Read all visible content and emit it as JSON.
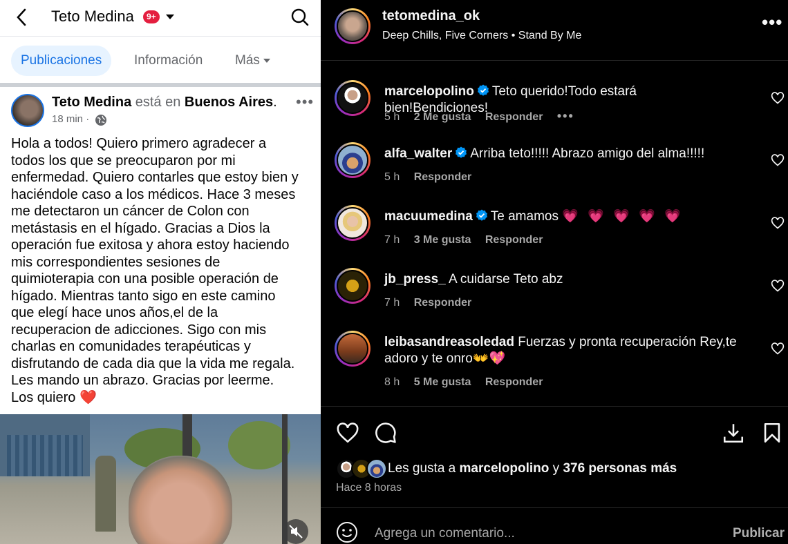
{
  "facebook": {
    "profile_name": "Teto Medina",
    "notification_badge": "9+",
    "tabs": [
      "Publicaciones",
      "Información",
      "Más"
    ],
    "post": {
      "author": "Teto Medina",
      "location_prefix": "está en",
      "location": "Buenos Aires",
      "time": "18 min ·",
      "body": "Hola a todos! Quiero primero agradecer a\ntodos los que se preocuparon por mi\nenfermedad. Quiero contarles que estoy bien y\nhaciéndole caso a los médicos. Hace 3 meses\nme detectaron un cáncer de Colon con\nmetástasis en el hígado. Gracias a Dios la\noperación fue exitosa y ahora estoy haciendo\nmis correspondientes sesiones de\nquimioterapia con una posible operación de\nhígado. Mientras tanto sigo en este camino\nque elegí hace unos años,el de la\nrecuperacion de adicciones.  Sigo con mis\ncharlas en comunidades terapéuticas y\ndisfrutando de cada dia que la vida me regala.\nLes mando un abrazo. Gracias por leerme.\nLos quiero ❤️"
    }
  },
  "instagram": {
    "username": "tetomedina_ok",
    "song": "Deep Chills, Five Corners • Stand By Me",
    "comments": [
      {
        "user": "marcelopolino",
        "verified": true,
        "text": "Teto querido!Todo estará bien!Bendiciones!",
        "time": "5 h",
        "likes": "2 Me gusta",
        "reply": "Responder",
        "more": "•••"
      },
      {
        "user": "alfa_walter",
        "verified": true,
        "text": "Arriba teto!!!!! Abrazo amigo del alma!!!!!",
        "time": "5 h",
        "likes": "",
        "reply": "Responder"
      },
      {
        "user": "macuumedina",
        "verified": true,
        "text": "Te amamos",
        "emoji": "💗 💗 💗 💗 💗",
        "time": "7 h",
        "likes": "3 Me gusta",
        "reply": "Responder"
      },
      {
        "user": "jb_press_",
        "verified": false,
        "text": "A cuidarse Teto abz",
        "time": "7 h",
        "likes": "",
        "reply": "Responder"
      },
      {
        "user": "leibasandreasoledad",
        "verified": false,
        "text": "Fuerzas y pronta recuperación Rey,te adoro y te onro👐💖",
        "time": "8 h",
        "likes": "5 Me gusta",
        "reply": "Responder"
      }
    ],
    "likes": {
      "prefix": "Les gusta a",
      "user": "marcelopolino",
      "conj": "y",
      "others": "376 personas más"
    },
    "since": "Hace 8 horas",
    "comment_placeholder": "Agrega un comentario...",
    "post_label": "Publicar",
    "colors": {
      "background": "#000000",
      "secondary_text": "#a8a8a8",
      "verified": "#0095f6",
      "heart": "#ff3b72"
    }
  }
}
